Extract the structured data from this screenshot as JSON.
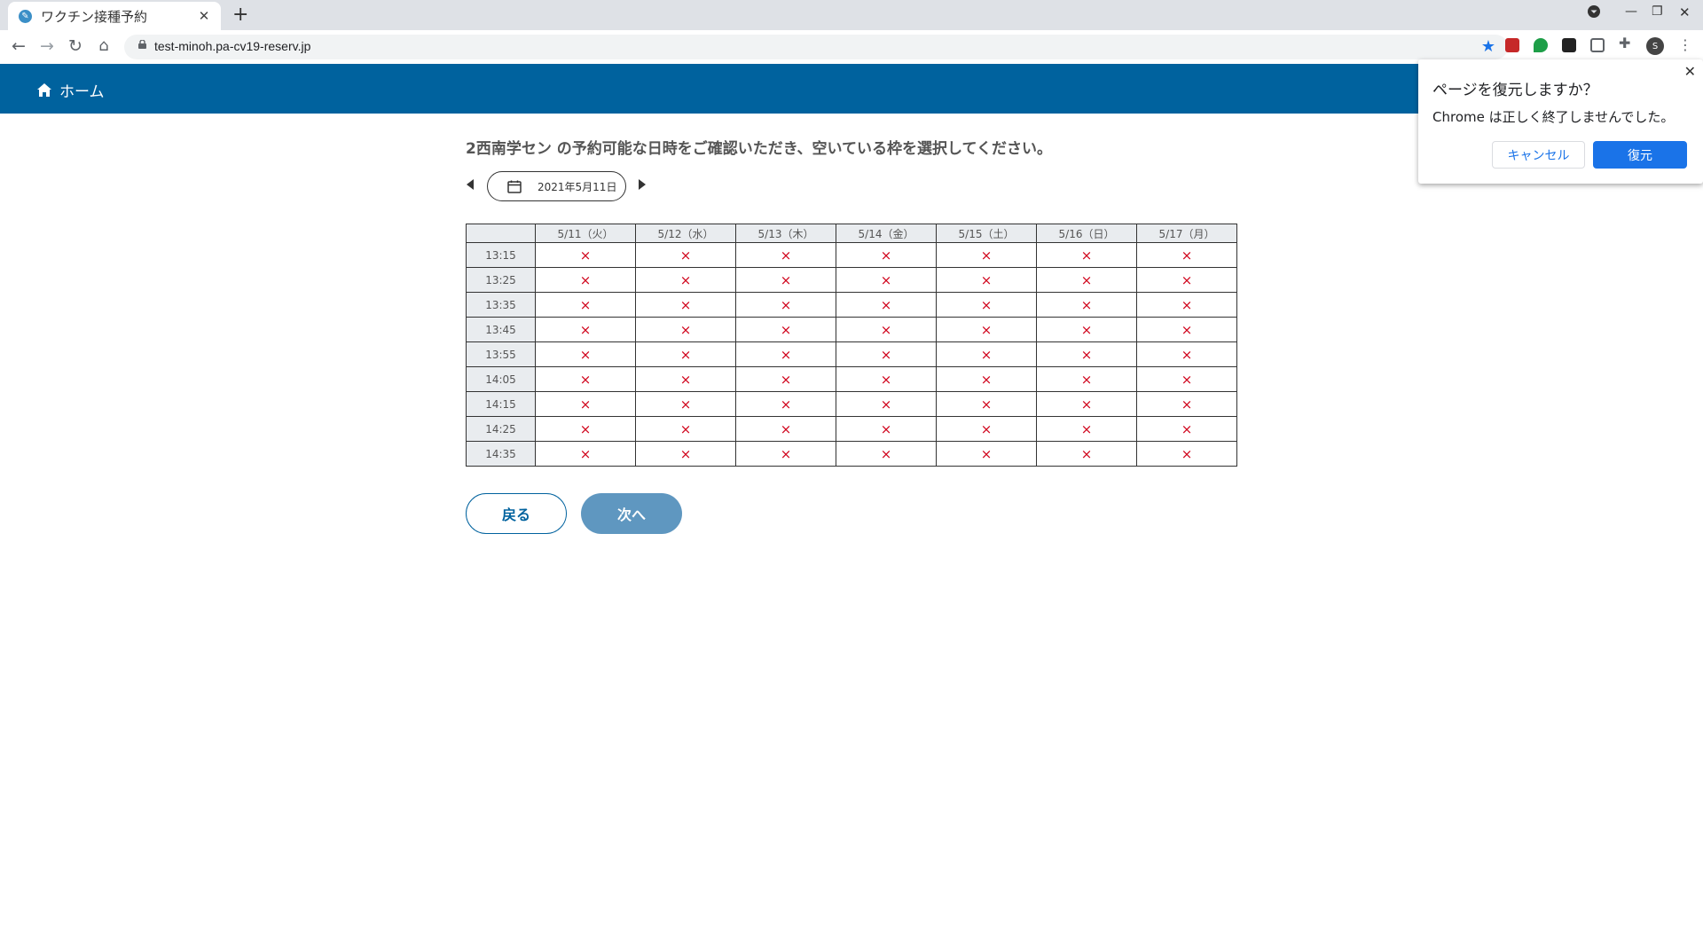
{
  "browser": {
    "tab_title": "ワクチン接種予約",
    "tab_close": "✕",
    "new_tab": "+",
    "url": "test-minoh.pa-cv19-reserv.jp",
    "avatar_letter": "S"
  },
  "header": {
    "home_label": "ホーム"
  },
  "main": {
    "instruction": "2西南学セン の予約可能な日時をご確認いただき、空いている枠を選択してください。",
    "selected_date": "2021年5月11日"
  },
  "schedule": {
    "columns": [
      "5/11（火）",
      "5/12（水）",
      "5/13（木）",
      "5/14（金）",
      "5/15（土）",
      "5/16（日）",
      "5/17（月）"
    ],
    "rows": [
      {
        "time": "13:15",
        "cells": [
          "×",
          "×",
          "×",
          "×",
          "×",
          "×",
          "×"
        ]
      },
      {
        "time": "13:25",
        "cells": [
          "×",
          "×",
          "×",
          "×",
          "×",
          "×",
          "×"
        ]
      },
      {
        "time": "13:35",
        "cells": [
          "×",
          "×",
          "×",
          "×",
          "×",
          "×",
          "×"
        ]
      },
      {
        "time": "13:45",
        "cells": [
          "×",
          "×",
          "×",
          "×",
          "×",
          "×",
          "×"
        ]
      },
      {
        "time": "13:55",
        "cells": [
          "×",
          "×",
          "×",
          "×",
          "×",
          "×",
          "×"
        ]
      },
      {
        "time": "14:05",
        "cells": [
          "×",
          "×",
          "×",
          "×",
          "×",
          "×",
          "×"
        ]
      },
      {
        "time": "14:15",
        "cells": [
          "×",
          "×",
          "×",
          "×",
          "×",
          "×",
          "×"
        ]
      },
      {
        "time": "14:25",
        "cells": [
          "×",
          "×",
          "×",
          "×",
          "×",
          "×",
          "×"
        ]
      },
      {
        "time": "14:35",
        "cells": [
          "×",
          "×",
          "×",
          "×",
          "×",
          "×",
          "×"
        ]
      }
    ]
  },
  "actions": {
    "back_label": "戻る",
    "next_label": "次へ"
  },
  "restore_dialog": {
    "title": "ページを復元しますか？",
    "message": "Chrome は正しく終了しませんでした。",
    "cancel_label": "キャンセル",
    "restore_label": "復元"
  },
  "colors": {
    "header_bg": "#00629e",
    "unavailable_mark": "#d0021b",
    "next_button": "#5f97c0",
    "dialog_primary": "#1a73e8"
  }
}
